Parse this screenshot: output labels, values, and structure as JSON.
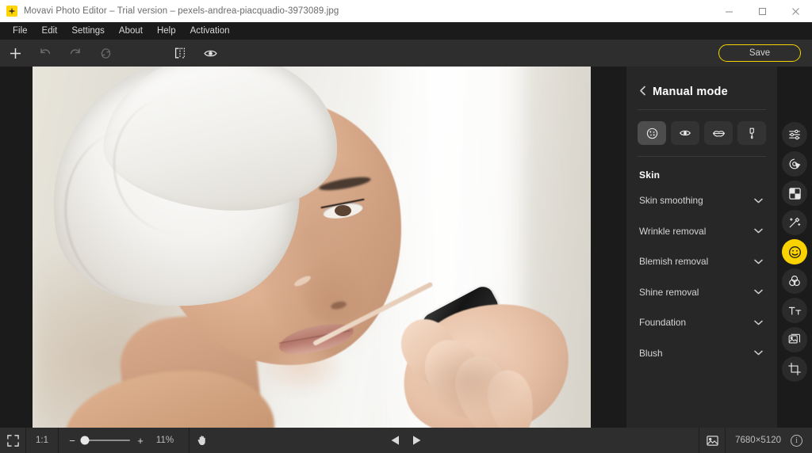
{
  "window": {
    "title": "Movavi Photo Editor – Trial version – pexels-andrea-piacquadio-3973089.jpg",
    "app_icon": "movavi-star-icon",
    "controls": {
      "minimize": "minimize-icon",
      "maximize": "maximize-icon",
      "close": "close-icon"
    },
    "titlebar_bg": "#ffffff",
    "accent": "#fad200"
  },
  "menubar": {
    "items": [
      {
        "label": "File"
      },
      {
        "label": "Edit"
      },
      {
        "label": "Settings"
      },
      {
        "label": "About"
      },
      {
        "label": "Help"
      },
      {
        "label": "Activation"
      }
    ]
  },
  "toolbar": {
    "buttons": [
      {
        "name": "add-image-button",
        "icon": "plus-icon",
        "enabled": true
      },
      {
        "name": "undo-button",
        "icon": "undo-arrow-icon",
        "enabled": false
      },
      {
        "name": "redo-button",
        "icon": "redo-arrow-icon",
        "enabled": false
      },
      {
        "name": "reset-button",
        "icon": "refresh-icon",
        "enabled": false
      },
      {
        "name": "compare-button",
        "icon": "before-after-split-icon",
        "enabled": true
      },
      {
        "name": "preview-button",
        "icon": "eye-icon",
        "enabled": true
      }
    ],
    "save_label": "Save"
  },
  "panel": {
    "back_icon": "chevron-left-icon",
    "title": "Manual mode",
    "tabs": [
      {
        "name": "tab-skin",
        "icon": "face-powder-icon",
        "active": true
      },
      {
        "name": "tab-eyes",
        "icon": "eye-icon",
        "active": false
      },
      {
        "name": "tab-lips",
        "icon": "lips-icon",
        "active": false
      },
      {
        "name": "tab-makeup-brush",
        "icon": "makeup-applicator-icon",
        "active": false
      }
    ],
    "section_title": "Skin",
    "options": [
      {
        "label": "Skin smoothing",
        "chevron": "chevron-down-icon"
      },
      {
        "label": "Wrinkle removal",
        "chevron": "chevron-down-icon"
      },
      {
        "label": "Blemish removal",
        "chevron": "chevron-down-icon"
      },
      {
        "label": "Shine removal",
        "chevron": "chevron-down-icon"
      },
      {
        "label": "Foundation",
        "chevron": "chevron-down-icon"
      },
      {
        "label": "Blush",
        "chevron": "chevron-down-icon"
      }
    ]
  },
  "rail": {
    "items": [
      {
        "name": "rail-adjust",
        "icon": "sliders-icon",
        "active": false
      },
      {
        "name": "rail-object-removal",
        "icon": "object-removal-cursor-icon",
        "active": false
      },
      {
        "name": "rail-background-removal",
        "icon": "checkerboard-icon",
        "active": false
      },
      {
        "name": "rail-ai-enhance",
        "icon": "magic-wand-icon",
        "active": false
      },
      {
        "name": "rail-beautify",
        "icon": "smiley-face-icon",
        "active": true
      },
      {
        "name": "rail-color",
        "icon": "color-circles-icon",
        "active": false
      },
      {
        "name": "rail-text",
        "icon": "text-tt-icon",
        "active": false
      },
      {
        "name": "rail-images",
        "icon": "photo-stack-icon",
        "active": false
      },
      {
        "name": "rail-crop",
        "icon": "crop-icon",
        "active": false
      }
    ],
    "active_color": "#fad200"
  },
  "statusbar": {
    "fit_icon": "fit-to-screen-icon",
    "ratio_label": "1:1",
    "zoom_minus": "−",
    "zoom_plus": "+",
    "zoom_percent": "11%",
    "zoom_fill": 5,
    "hand_icon": "hand-pan-icon",
    "prev_icon": "previous-triangle-icon",
    "next_icon": "next-triangle-icon",
    "gallery_icon": "image-icon",
    "dimensions": "7680×5120",
    "info_icon": "info-icon",
    "info_glyph": "i"
  },
  "canvas": {
    "image_name": "portrait-woman-towel-applying-lip-gloss",
    "background": "#1b1b1b"
  }
}
